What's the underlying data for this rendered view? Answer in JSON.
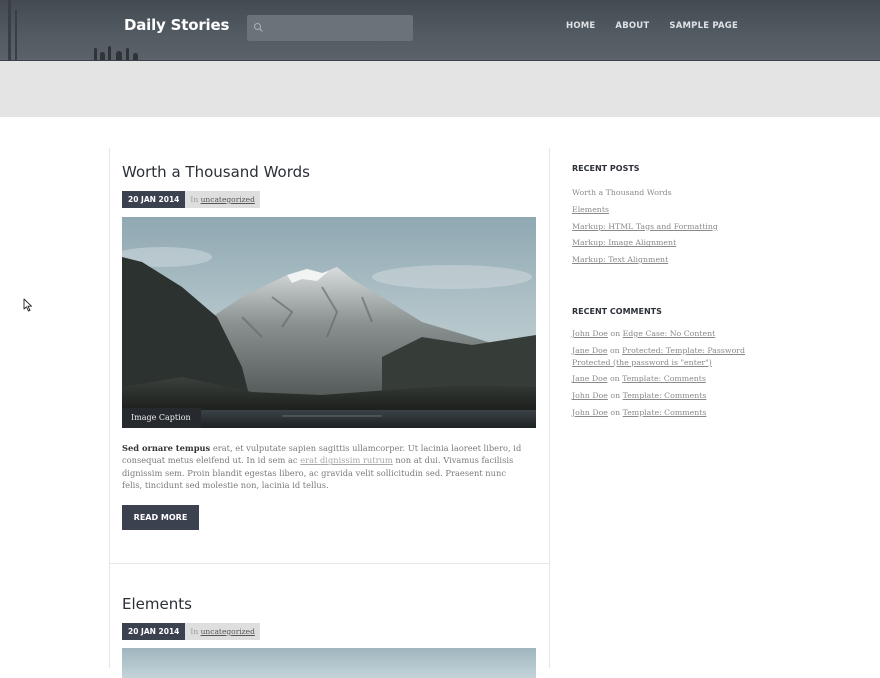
{
  "header": {
    "site_title": "Daily Stories",
    "search": {
      "value": "",
      "placeholder": ""
    },
    "nav": [
      "HOME",
      "ABOUT",
      "SAMPLE PAGE"
    ]
  },
  "posts": [
    {
      "title": "Worth a Thousand Words",
      "date": "20 JAN 2014",
      "category_prefix": "In",
      "category": "uncategorized",
      "image_caption": "Image Caption",
      "excerpt": {
        "lead": "Sed ornare tempus",
        "part1": " erat, et vulputate sapien sagittis ullamcorper. Ut lacinia laoreet libero, id consequat metus eleifend ut. In id sem ac ",
        "link": "erat dignissim rutrum",
        "part2": " non at dui. Vivamus facilisis dignissim sem. Proin blandit egestas libero, ac gravida velit sollicitudin sed. Praesent nunc felis, tincidunt sed molestie non, lacinia id tellus."
      },
      "read_more": "READ MORE"
    },
    {
      "title": "Elements",
      "date": "20 JAN 2014",
      "category_prefix": "In",
      "category": "uncategorized"
    }
  ],
  "sidebar": {
    "recent_posts": {
      "title": "RECENT POSTS",
      "items": [
        "Worth a Thousand Words",
        "Elements",
        "Markup: HTML Tags and Formatting",
        "Markup: Image Alignment",
        "Markup: Text Alignment"
      ]
    },
    "recent_comments": {
      "title": "RECENT COMMENTS",
      "connector": "on",
      "items": [
        {
          "author": "John Doe",
          "post": "Edge Case: No Content"
        },
        {
          "author": "Jane Doe",
          "post": "Protected: Template: Password",
          "post_line2": "Protected (the password is \"enter\")"
        },
        {
          "author": "Jane Doe",
          "post": "Template: Comments"
        },
        {
          "author": "John Doe",
          "post": "Template: Comments"
        },
        {
          "author": "John Doe",
          "post": "Template: Comments"
        }
      ]
    }
  },
  "colors": {
    "header_bg": "#4f565d",
    "band_bg": "#e4e4e4",
    "button_bg": "#3c4150",
    "title_text": "#2b3038"
  }
}
